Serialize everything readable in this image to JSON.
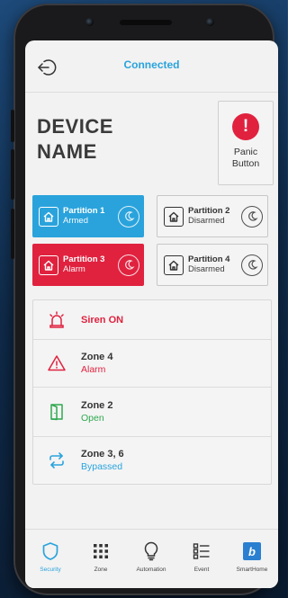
{
  "header": {
    "connection_status": "Connected"
  },
  "device": {
    "name": "DEVICE\nNAME"
  },
  "panic": {
    "label_line1": "Panic",
    "label_line2": "Button",
    "symbol": "!"
  },
  "partitions": [
    {
      "name": "Partition 1",
      "status": "Armed",
      "color": "#2aa3dc"
    },
    {
      "name": "Partition 2",
      "status": "Disarmed",
      "color": "#f4f4f4"
    },
    {
      "name": "Partition 3",
      "status": "Alarm",
      "color": "#e0223f"
    },
    {
      "name": "Partition 4",
      "status": "Disarmed",
      "color": "#f4f4f4"
    }
  ],
  "events": [
    {
      "title": "Siren ON",
      "subtitle": "",
      "icon": "siren-icon",
      "color": "#e0223f"
    },
    {
      "title": "Zone 4",
      "subtitle": "Alarm",
      "icon": "warning-icon",
      "color": "#e0223f"
    },
    {
      "title": "Zone 2",
      "subtitle": "Open",
      "icon": "open-door-icon",
      "color": "#2fa84f"
    },
    {
      "title": "Zone 3, 6",
      "subtitle": "Bypassed",
      "icon": "bypass-arrows-icon",
      "color": "#2aa3dc"
    }
  ],
  "nav": [
    {
      "label": "Security",
      "icon": "shield-icon",
      "active": true
    },
    {
      "label": "Zone",
      "icon": "grid-icon",
      "active": false
    },
    {
      "label": "Automation",
      "icon": "lightbulb-icon",
      "active": false
    },
    {
      "label": "Event",
      "icon": "list-icon",
      "active": false
    },
    {
      "label": "SmartHome",
      "icon": "smarthome-logo-icon",
      "active": false
    }
  ],
  "colors": {
    "accent_blue": "#2aa3dc",
    "alarm_red": "#e0223f",
    "open_green": "#2fa84f"
  }
}
